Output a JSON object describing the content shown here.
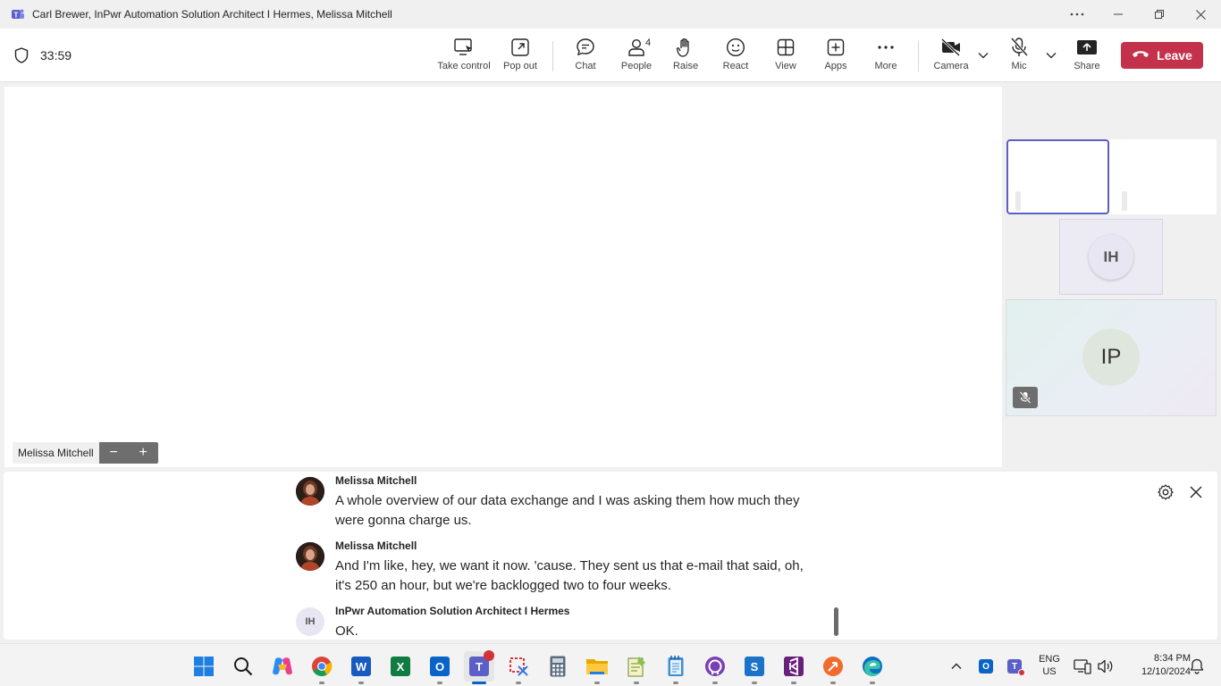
{
  "window": {
    "title": "Carl Brewer, InPwr Automation Solution Architect I Hermes, Melissa Mitchell",
    "controls": [
      "more-icon",
      "minimize-icon",
      "restore-icon",
      "close-icon"
    ]
  },
  "toolbar": {
    "timer": "33:59",
    "buttons": {
      "take_control": "Take control",
      "pop_out": "Pop out",
      "chat": "Chat",
      "people": "People",
      "people_count": "4",
      "raise": "Raise",
      "react": "React",
      "view": "View",
      "apps": "Apps",
      "more": "More",
      "camera": "Camera",
      "mic": "Mic",
      "share": "Share"
    },
    "leave": "Leave",
    "colors": {
      "leave": "#c4314b",
      "accent": "#5b5fc7"
    }
  },
  "stage": {
    "presenter_name": "Melissa Mitchell",
    "zoom_out": "−",
    "zoom_in": "+"
  },
  "participants": {
    "ih_initials": "IH",
    "ip_initials": "IP"
  },
  "captions": {
    "entries": [
      {
        "speaker": "Melissa Mitchell",
        "text": "A whole overview of our data exchange and I was asking them how much they were gonna charge us."
      },
      {
        "speaker": "Melissa Mitchell",
        "text": "And I'm like, hey, we want it now. 'cause. They sent us that e-mail that said, oh, it's 250 an hour, but we're backlogged two to four weeks."
      },
      {
        "speaker": "InPwr Automation Solution Architect I Hermes",
        "initials": "IH",
        "text": "OK."
      }
    ]
  },
  "taskbar": {
    "apps": [
      "windows-start",
      "search",
      "copilot",
      "chrome",
      "word",
      "excel",
      "outlook",
      "teams",
      "snipping-tool",
      "calculator",
      "file-explorer",
      "notepad-plus",
      "notepad",
      "github-desktop",
      "sharepoint",
      "visual-studio",
      "swift",
      "edge"
    ],
    "language": {
      "line1": "ENG",
      "line2": "US"
    },
    "time": "8:34 PM",
    "date": "12/10/2024"
  }
}
